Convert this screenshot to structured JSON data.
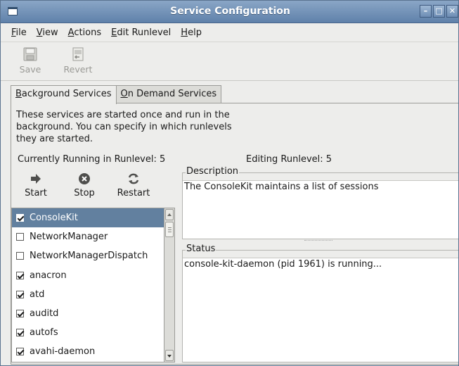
{
  "window": {
    "title": "Service Configuration"
  },
  "menu": [
    {
      "key": "F",
      "rest": "ile"
    },
    {
      "key": "V",
      "rest": "iew"
    },
    {
      "key": "A",
      "rest": "ctions"
    },
    {
      "key": "E",
      "rest": "dit Runlevel"
    },
    {
      "key": "H",
      "rest": "elp"
    }
  ],
  "toolbar": {
    "save_label": "Save",
    "revert_label": "Revert",
    "save_icon": "floppy-disk-icon",
    "revert_icon": "revert-document-icon",
    "disabled": true
  },
  "tabs": [
    {
      "key": "B",
      "rest": "ackground Services",
      "active": true
    },
    {
      "key": "O",
      "rest": "n Demand Services",
      "active": false
    }
  ],
  "panel": {
    "description_text": "These services are started once and run in the background. You can specify in which runlevels they are started.",
    "current_runlevel": "Currently Running in Runlevel: 5",
    "editing_runlevel": "Editing Runlevel: 5"
  },
  "actions": {
    "start_label": "Start",
    "stop_label": "Stop",
    "restart_label": "Restart"
  },
  "services": [
    {
      "name": "ConsoleKit",
      "checked": true,
      "selected": true
    },
    {
      "name": "NetworkManager",
      "checked": false,
      "selected": false
    },
    {
      "name": "NetworkManagerDispatch",
      "checked": false,
      "selected": false
    },
    {
      "name": "anacron",
      "checked": true,
      "selected": false
    },
    {
      "name": "atd",
      "checked": true,
      "selected": false
    },
    {
      "name": "auditd",
      "checked": true,
      "selected": false
    },
    {
      "name": "autofs",
      "checked": true,
      "selected": false
    },
    {
      "name": "avahi-daemon",
      "checked": true,
      "selected": false
    }
  ],
  "description_frame": {
    "label": "Description",
    "text": "The ConsoleKit maintains a list of sessions"
  },
  "status_frame": {
    "label": "Status",
    "text": "console-kit-daemon (pid 1961) is running..."
  },
  "colors": {
    "titlebar": "#6f8fb5",
    "selection": "#62809f",
    "background": "#ededeb"
  }
}
